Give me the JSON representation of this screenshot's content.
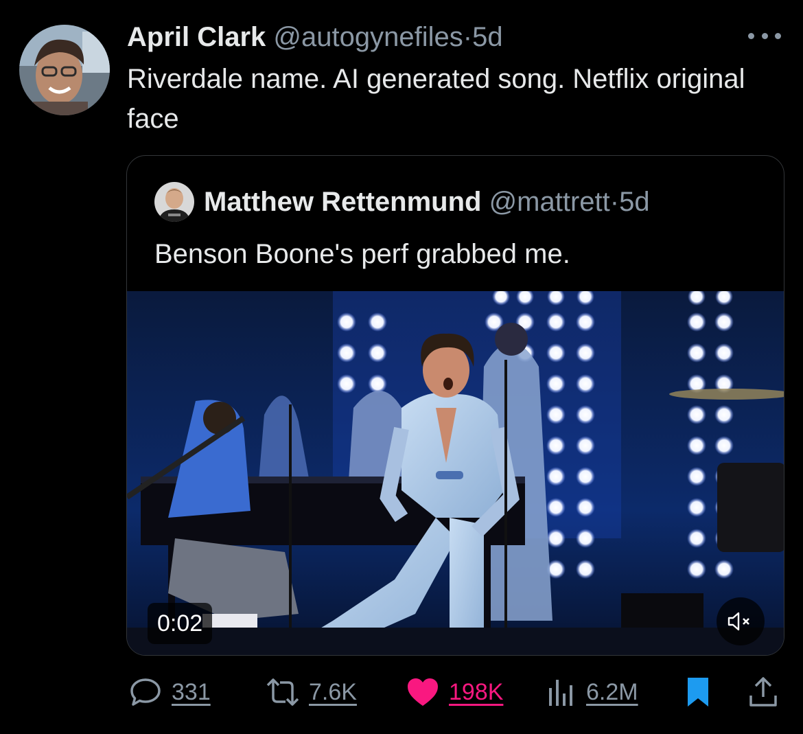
{
  "post": {
    "author_name": "April Clark",
    "author_handle": "@autogynefiles",
    "separator": "·",
    "time": "5d",
    "text": "Riverdale name. AI generated song. Netflix original face",
    "avatar_icon": "profile-photo"
  },
  "quoted": {
    "author_name": "Matthew Rettenmund",
    "author_handle": "@mattrett",
    "separator": "·",
    "time": "5d",
    "text": "Benson Boone's perf grabbed me.",
    "avatar_icon": "profile-photo",
    "video": {
      "timestamp": "0:02",
      "mute_icon": "speaker-muted-icon"
    }
  },
  "actions": {
    "replies": "331",
    "reposts": "7.6K",
    "likes": "198K",
    "views": "6.2M",
    "liked": true,
    "bookmarked": true
  },
  "colors": {
    "background": "#000000",
    "text_primary": "#e7e9ea",
    "text_secondary": "#8b98a5",
    "like_pink": "#f91880",
    "bookmark_blue": "#1d9bf0",
    "border": "#333639"
  }
}
